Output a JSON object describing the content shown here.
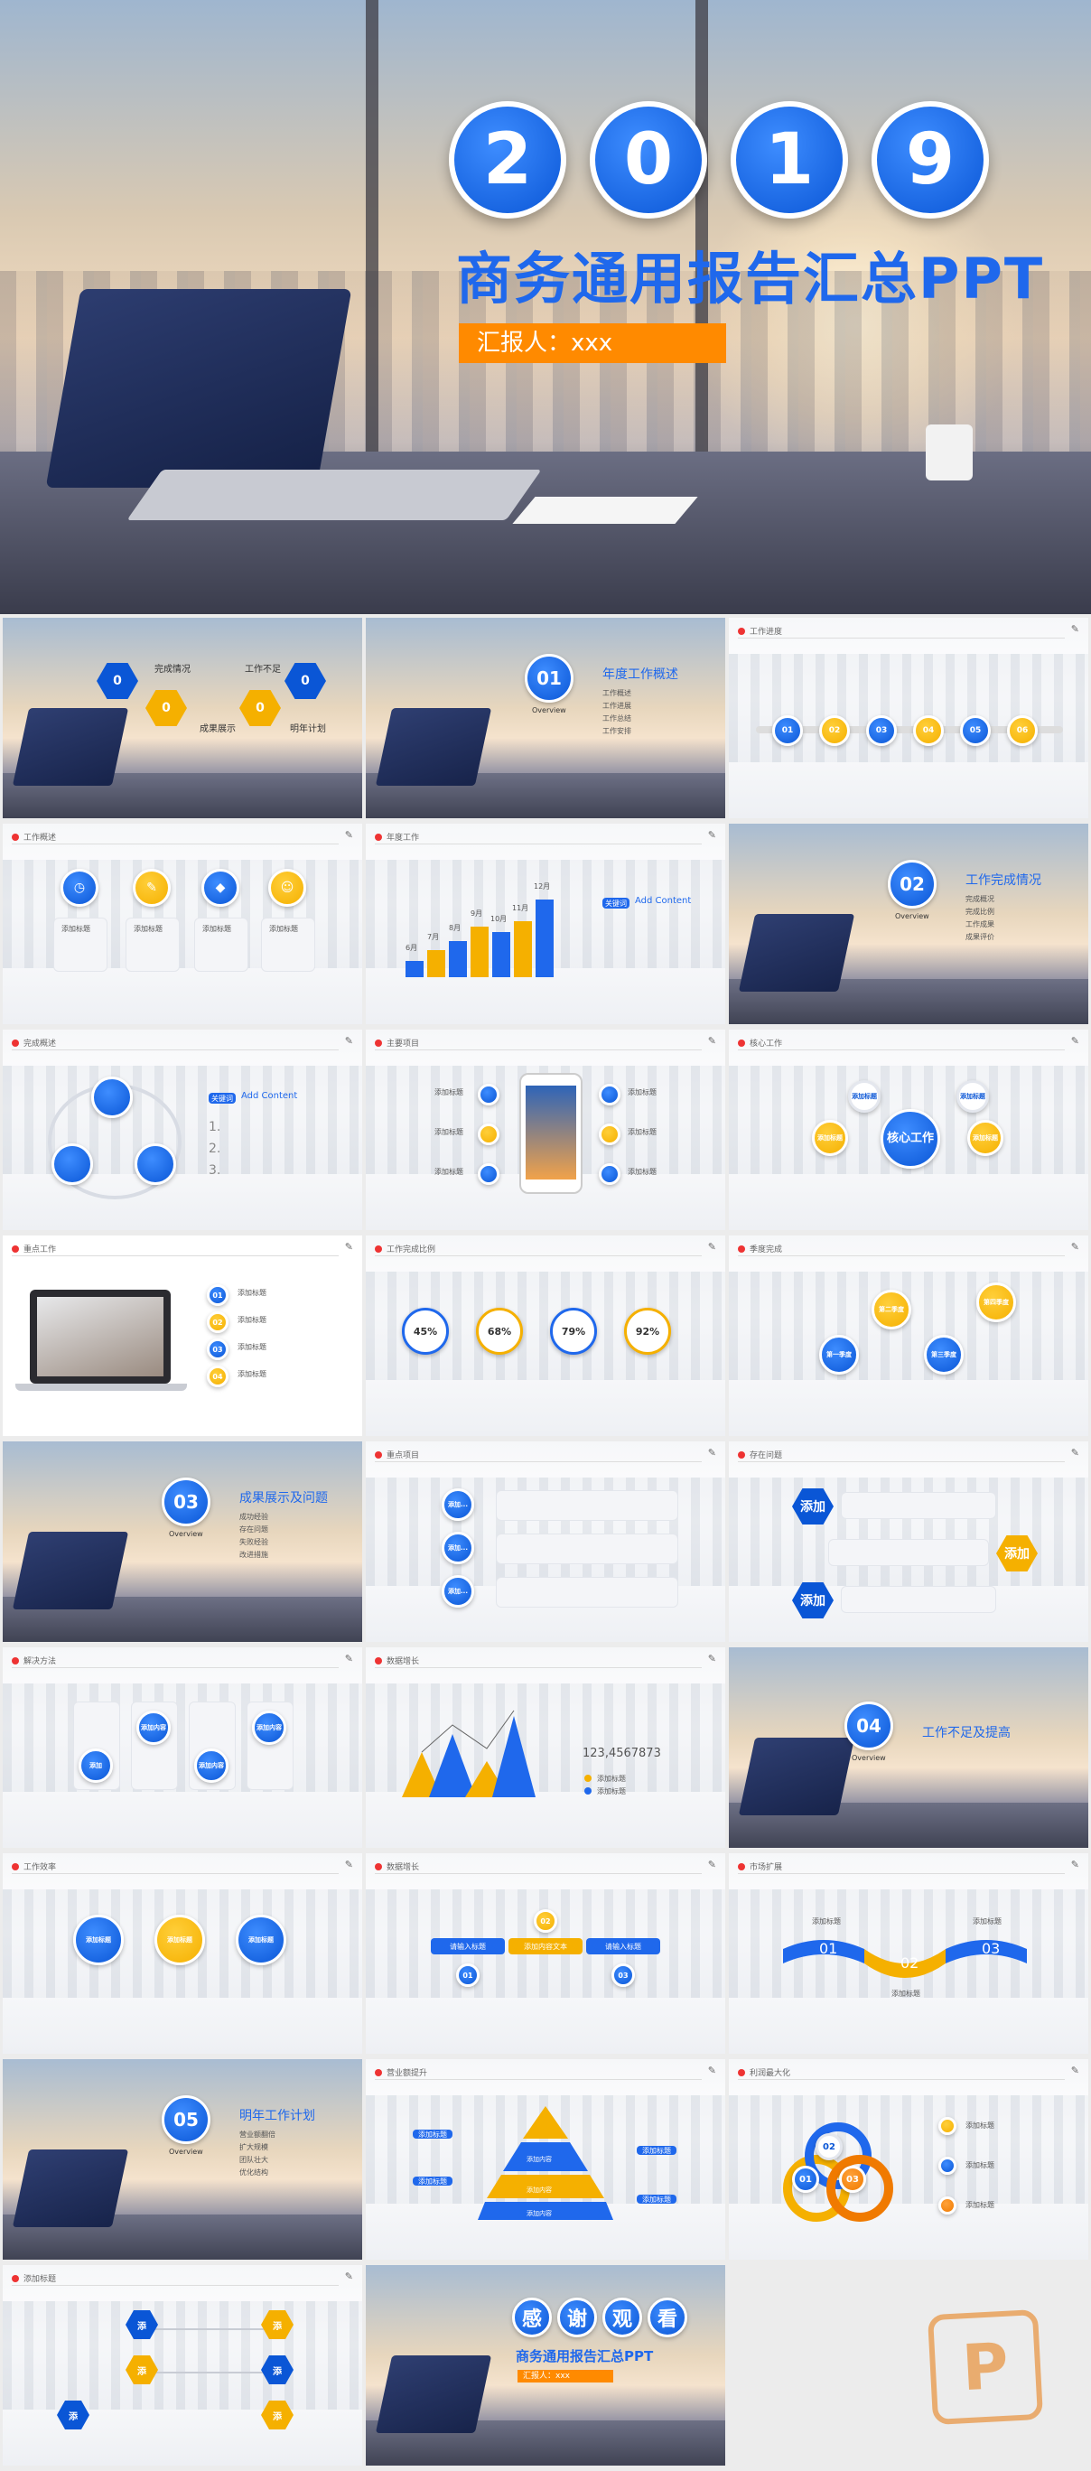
{
  "cover": {
    "year_digits": [
      "2",
      "0",
      "1",
      "9"
    ],
    "title": "商务通用报告汇总PPT",
    "reporter": "汇报人：xxx"
  },
  "slide2": {
    "hex_values": [
      "0",
      "0",
      "0",
      "0"
    ],
    "labels": [
      "完成情况",
      "工作不足",
      "明年计划",
      "成果展示"
    ]
  },
  "slide3": {
    "num": "01",
    "title": "年度工作概述",
    "overview": "Overview",
    "items": [
      "工作概述",
      "工作进展",
      "工作总结",
      "工作安排"
    ]
  },
  "slide4": {
    "header": "工作进度",
    "nodes": [
      "01",
      "02",
      "03",
      "04",
      "05",
      "06"
    ]
  },
  "slide5": {
    "header": "工作概述",
    "items": [
      "添加标题",
      "添加标题",
      "添加标题",
      "添加标题"
    ]
  },
  "slide6": {
    "header": "年度工作",
    "months": [
      "6月",
      "7月",
      "8月",
      "9月",
      "10月",
      "11月",
      "12月"
    ],
    "add_content": "Add Content",
    "badge": "关键词"
  },
  "slide7": {
    "num": "02",
    "title": "工作完成情况",
    "overview": "Overview",
    "items": [
      "完成概况",
      "完成比例",
      "工作成果",
      "成果评价"
    ]
  },
  "slide8": {
    "header": "完成概述",
    "add_content": "Add Content",
    "badge": "关键词",
    "steps": [
      "1.",
      "2.",
      "3."
    ]
  },
  "slide9": {
    "header": "主要项目",
    "labels": [
      "添加标题",
      "添加标题",
      "添加标题",
      "添加标题",
      "添加标题",
      "添加标题"
    ]
  },
  "slide10": {
    "header": "核心工作",
    "center": "核心工作",
    "nodes": [
      "添加标题",
      "添加标题",
      "添加标题",
      "添加标题"
    ]
  },
  "slide11": {
    "header": "重点工作",
    "nums": [
      "01",
      "02",
      "03",
      "04"
    ],
    "labels": [
      "添加标题",
      "添加标题",
      "添加标题",
      "添加标题"
    ]
  },
  "slide12": {
    "header": "工作完成比例",
    "percents": [
      "45%",
      "68%",
      "79%",
      "92%"
    ],
    "percent_values": [
      45,
      68,
      79,
      92
    ]
  },
  "slide13": {
    "header": "季度完成",
    "nodes": [
      "第一季度",
      "第二季度",
      "第三季度",
      "第四季度"
    ]
  },
  "slide14": {
    "num": "03",
    "title": "成果展示及问题",
    "overview": "Overview",
    "items": [
      "成功经验",
      "存在问题",
      "失败经验",
      "改进措施"
    ]
  },
  "slide15": {
    "header": "重点项目",
    "circles": [
      "添加...",
      "添加...",
      "添加..."
    ]
  },
  "slide16": {
    "header": "存在问题",
    "hexes": [
      "添加",
      "添加",
      "添加"
    ]
  },
  "slide17": {
    "header": "解决方法",
    "cards": [
      "添加内容",
      "添加内容",
      "添加",
      "添加内容"
    ]
  },
  "slide18": {
    "header": "数据增长",
    "number": "123,4567873",
    "legend": [
      "添加标题",
      "添加标题"
    ]
  },
  "slide19": {
    "num": "04",
    "title": "工作不足及提高",
    "overview": "Overview",
    "items": [
      "工作不足",
      "改善方法",
      "提高措施",
      "总结经验"
    ]
  },
  "slide20": {
    "header": "工作效率",
    "labels": [
      "添加标题",
      "添加标题",
      "添加标题"
    ]
  },
  "slide21": {
    "header": "数据增长",
    "bars": [
      "请输入标题",
      "添加内容文本",
      "请输入标题"
    ],
    "nums": [
      "01",
      "02",
      "03"
    ]
  },
  "slide22": {
    "header": "市场扩展",
    "nums": [
      "01",
      "02",
      "03"
    ],
    "labels": [
      "添加标题",
      "添加标题",
      "添加标题"
    ]
  },
  "slide23": {
    "num": "05",
    "title": "明年工作计划",
    "overview": "Overview",
    "items": [
      "营业额翻倍",
      "扩大规模",
      "团队壮大",
      "优化结构"
    ]
  },
  "slide24": {
    "header": "营业额提升",
    "levels": [
      "添加内容",
      "添加内容",
      "添加内容"
    ],
    "tags": [
      "添加标题",
      "添加标题",
      "添加标题",
      "添加标题"
    ]
  },
  "slide25": {
    "header": "利润最大化",
    "nums": [
      "01",
      "02",
      "03"
    ],
    "labels": [
      "添加标题",
      "添加标题",
      "添加标题"
    ]
  },
  "slide26": {
    "header": "添加标题",
    "hexes": [
      "添",
      "添",
      "添",
      "添",
      "添",
      "添"
    ]
  },
  "slide27": {
    "thanks": [
      "感",
      "谢",
      "观",
      "看"
    ],
    "title": "商务通用报告汇总PPT",
    "reporter": "汇报人：xxx"
  },
  "watermark": {
    "letter": "P"
  }
}
